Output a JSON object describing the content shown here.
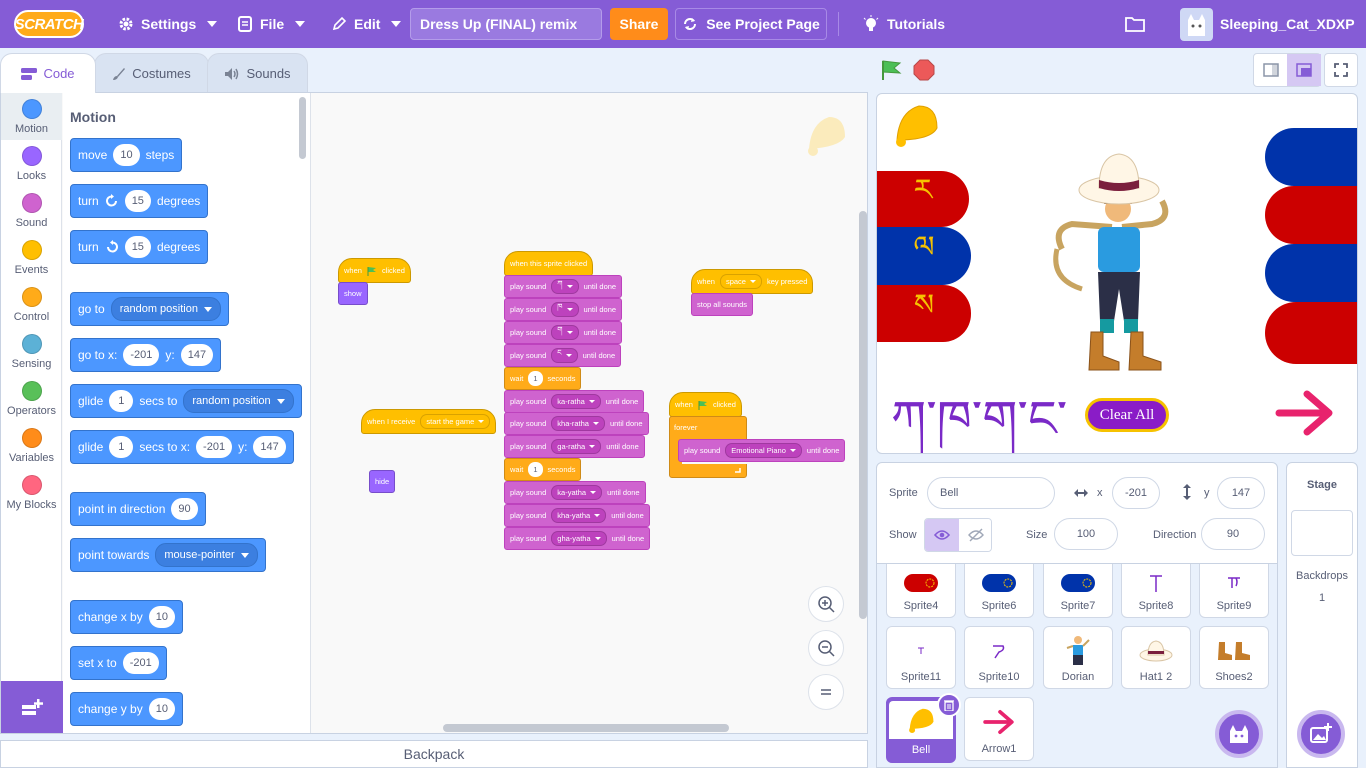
{
  "menubar": {
    "logo": "SCRATCH",
    "settings": "Settings",
    "file": "File",
    "edit": "Edit",
    "project_title": "Dress Up (FINAL) remix",
    "share": "Share",
    "see_project": "See Project Page",
    "tutorials": "Tutorials",
    "username": "Sleeping_Cat_XDXP"
  },
  "tabs": {
    "code": "Code",
    "costumes": "Costumes",
    "sounds": "Sounds"
  },
  "categories": [
    "Motion",
    "Looks",
    "Sound",
    "Events",
    "Control",
    "Sensing",
    "Operators",
    "Variables",
    "My Blocks"
  ],
  "category_colors": [
    "#4c97ff",
    "#9966ff",
    "#cf63cf",
    "#ffbf00",
    "#ffab19",
    "#5cb1d6",
    "#59c059",
    "#ff8c1a",
    "#ff6680"
  ],
  "palette": {
    "title": "Motion",
    "move": {
      "pre": "move",
      "val": "10",
      "post": "steps"
    },
    "turn_right": {
      "pre": "turn",
      "val": "15",
      "post": "degrees"
    },
    "turn_left": {
      "pre": "turn",
      "val": "15",
      "post": "degrees"
    },
    "goto": {
      "pre": "go to",
      "dd": "random position"
    },
    "gotoxy": {
      "pre": "go to x:",
      "x": "-201",
      "mid": "y:",
      "y": "147"
    },
    "glide_rand": {
      "pre": "glide",
      "val": "1",
      "mid": "secs to",
      "dd": "random position"
    },
    "glide_xy": {
      "pre": "glide",
      "val": "1",
      "mid": "secs to x:",
      "x": "-201",
      "mid2": "y:",
      "y": "147"
    },
    "point_dir": {
      "pre": "point in direction",
      "val": "90"
    },
    "point_towards": {
      "pre": "point towards",
      "dd": "mouse-pointer"
    },
    "change_x": {
      "pre": "change x by",
      "val": "10"
    },
    "set_x": {
      "pre": "set x to",
      "val": "-201"
    },
    "change_y": {
      "pre": "change y by",
      "val": "10"
    }
  },
  "scripts": {
    "s1": {
      "when": "when",
      "clicked": "clicked",
      "show": "show"
    },
    "s2": {
      "hat": "when this sprite clicked",
      "play": "play sound",
      "until": "until done",
      "wait": "wait",
      "seconds": "seconds",
      "one": "1",
      "sounds": [
        "ཀ",
        "ཁ",
        "ག",
        "ང",
        "ka-ratha",
        "kha-ratha",
        "ga-ratha",
        "ka-yatha",
        "kha-yatha",
        "gha-yatha"
      ]
    },
    "s3": {
      "when": "when",
      "key": "space",
      "pressed": "key pressed",
      "stop": "stop all sounds"
    },
    "s4": {
      "when": "when I receive",
      "msg": "start the game",
      "hide": "hide"
    },
    "s5": {
      "when": "when",
      "clicked": "clicked",
      "forever": "forever",
      "play": "play sound",
      "sound": "Emotional Piano",
      "until": "until done"
    }
  },
  "backpack": "Backpack",
  "stage": {
    "letters": [
      "ར",
      "ལ",
      "ས"
    ],
    "tibetan_text": "ཀ་ཁ་ག་ང་",
    "clear_all": "Clear All"
  },
  "sprite_info": {
    "sprite_label": "Sprite",
    "sprite_name": "Bell",
    "x_label": "x",
    "x": "-201",
    "y_label": "y",
    "y": "147",
    "show_label": "Show",
    "size_label": "Size",
    "size": "100",
    "direction_label": "Direction",
    "direction": "90"
  },
  "sprites": [
    "Sprite4",
    "Sprite6",
    "Sprite7",
    "Sprite8",
    "Sprite9",
    "Sprite11",
    "Sprite10",
    "Dorian",
    "Hat1 2",
    "Shoes2",
    "Bell",
    "Arrow1"
  ],
  "stage_panel": {
    "title": "Stage",
    "backdrops_label": "Backdrops",
    "backdrops_count": "1"
  }
}
